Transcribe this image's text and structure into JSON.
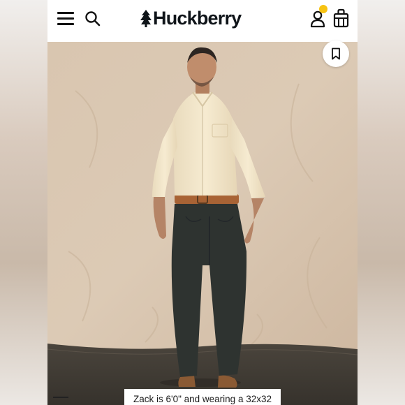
{
  "header": {
    "brand": "Huckberry",
    "icons": [
      "hamburger-menu-icon",
      "search-icon",
      "user-account-icon",
      "notification-dot",
      "shopping-bag-icon"
    ],
    "notification_color": "#f7c313"
  },
  "product_image": {
    "save_icon": "bookmark-icon",
    "caption": "Zack is 6'0\" and wearing a 32x32"
  },
  "colors": {
    "backdrop": "#d8c4ad",
    "floor": "#3f3a33",
    "shirt": "#f3e6c9",
    "pants": "#2e3330",
    "belt": "#a86335"
  }
}
